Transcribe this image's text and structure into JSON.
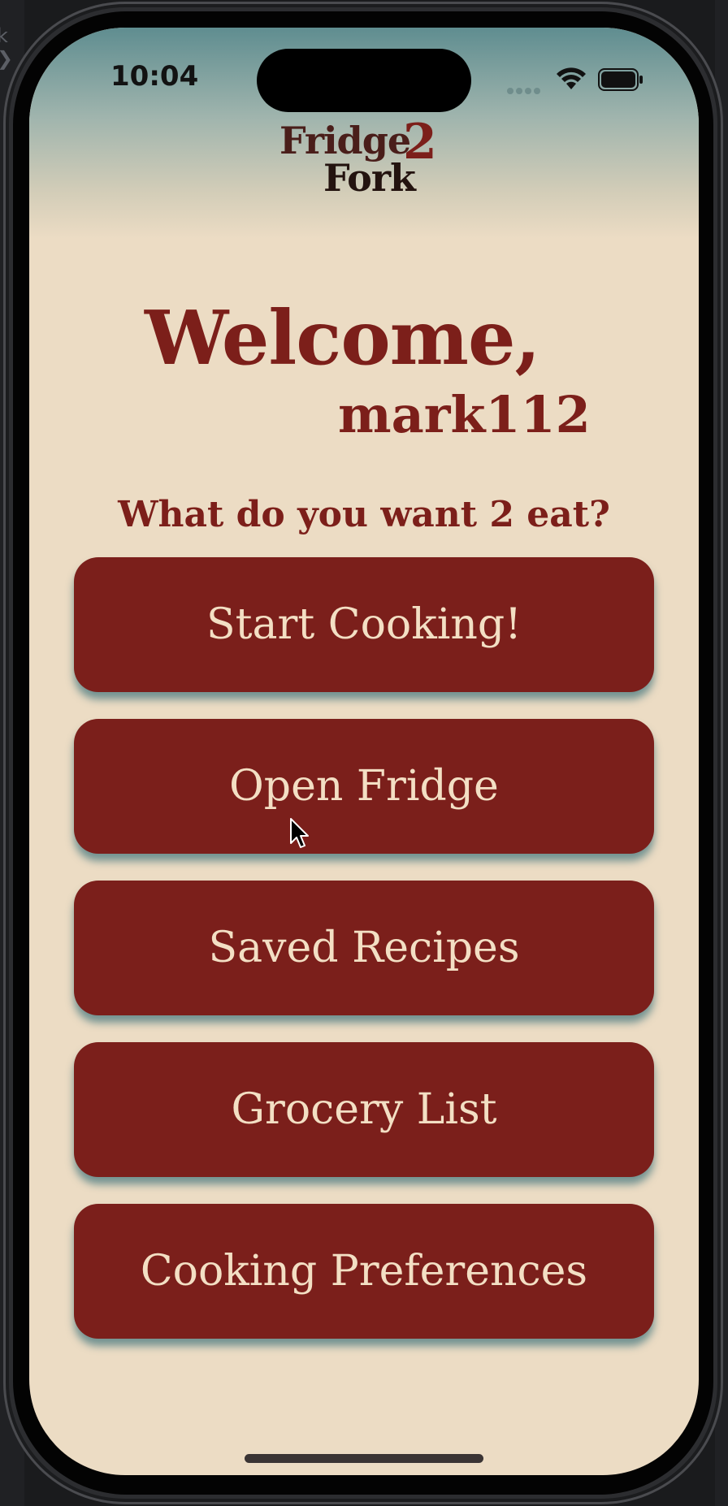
{
  "desktop": {
    "crumb": "k ❯"
  },
  "status_bar": {
    "time": "10:04",
    "icons": [
      "signal-dots-icon",
      "wifi-icon",
      "battery-icon"
    ]
  },
  "logo": {
    "line1": "Fridge",
    "two": "2",
    "line2": "Fork"
  },
  "welcome": {
    "greeting": "Welcome,",
    "username": "mark112",
    "prompt": "What do you want 2 eat?"
  },
  "menu": {
    "buttons": [
      {
        "label": "Start Cooking!"
      },
      {
        "label": "Open Fridge"
      },
      {
        "label": "Saved Recipes"
      },
      {
        "label": "Grocery List"
      },
      {
        "label": "Cooking Preferences"
      }
    ]
  },
  "colors": {
    "accent": "#7b1f1b",
    "background": "#ecdcc4",
    "button_text": "#f3dfc4",
    "header_teal": "#5f8d90"
  }
}
